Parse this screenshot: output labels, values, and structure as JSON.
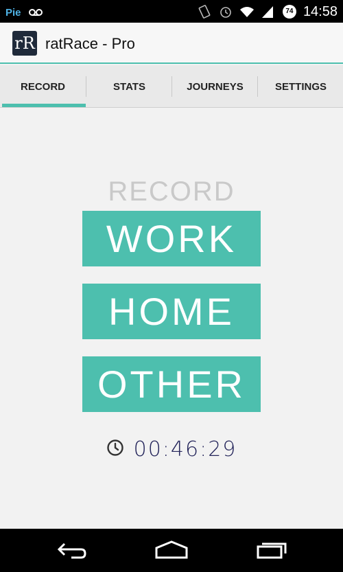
{
  "status_bar": {
    "carrier": "Pie",
    "time": "14:58",
    "battery_level": "74",
    "icons": [
      "voicemail-icon",
      "vibrate-icon",
      "alarm-icon",
      "wifi-icon",
      "signal-icon",
      "battery-icon"
    ]
  },
  "app": {
    "logo_text": "rR",
    "title": "ratRace - Pro"
  },
  "tabs": [
    {
      "label": "RECORD",
      "selected": true
    },
    {
      "label": "STATS",
      "selected": false
    },
    {
      "label": "JOURNEYS",
      "selected": false
    },
    {
      "label": "SETTINGS",
      "selected": false
    }
  ],
  "record": {
    "heading": "RECORD",
    "buttons": [
      "WORK",
      "HOME",
      "OTHER"
    ],
    "timer": "00:46:29",
    "timer_icon": "clock-icon"
  },
  "nav_bar": {
    "icons": [
      "back-icon",
      "home-icon",
      "recents-icon"
    ]
  },
  "colors": {
    "accent": "#4dbfae",
    "background": "#f2f2f2",
    "timer_text": "#23245a",
    "heading_text": "#c9c9c9"
  }
}
